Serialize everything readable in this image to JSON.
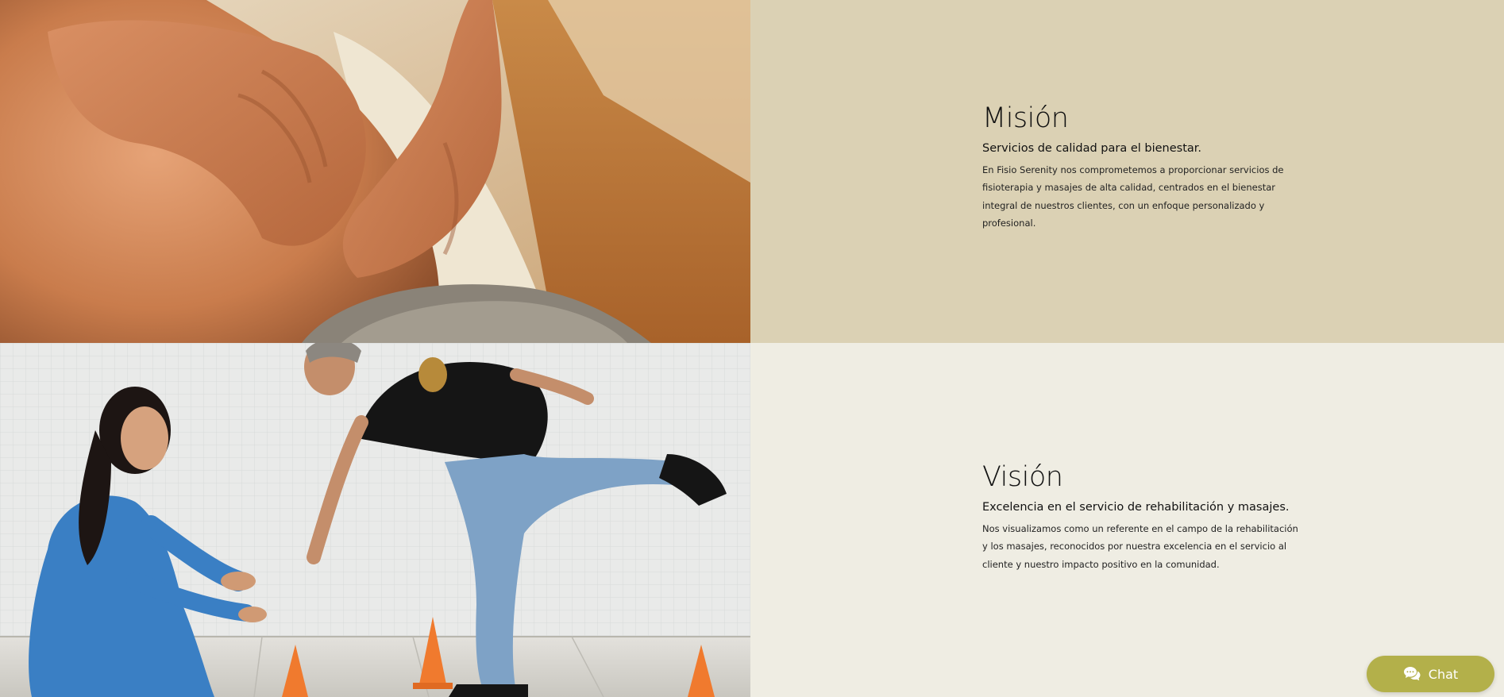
{
  "mission": {
    "heading": "Misión",
    "subtitle": "Servicios de calidad para el bienestar.",
    "body": "En Fisio Serenity nos comprometemos a proporcionar servicios de fisioterapia y masajes de alta calidad, centrados en el bienestar integral de nuestros clientes, con un enfoque personalizado y profesional."
  },
  "vision": {
    "heading": "Visión",
    "subtitle": "Excelencia en el servicio de rehabilitación y masajes.",
    "body": "Nos visualizamos como un referente en el campo de la rehabilitación y los masajes, reconocidos por nuestra excelencia en el servicio al cliente y nuestro impacto positivo en la comunidad."
  },
  "chat": {
    "label": "Chat",
    "icon": "chat-bubbles-icon"
  },
  "colors": {
    "mission_panel": "#dbd1b4",
    "vision_panel": "#efede3",
    "chat_button": "#b3b04a"
  }
}
